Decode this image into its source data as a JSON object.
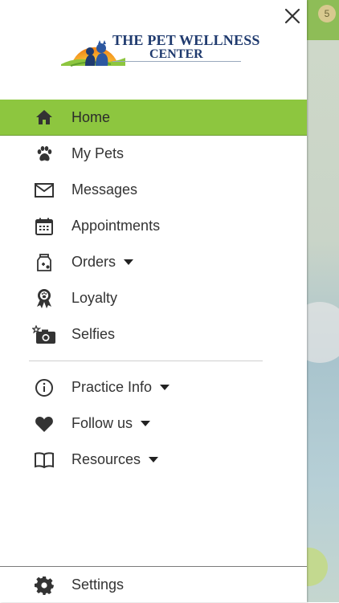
{
  "brand": {
    "line1": "THE PET WELLNESS",
    "line2": "CENTER",
    "accent_color": "#8dc63f",
    "navy": "#1f3a6e"
  },
  "background_app": {
    "badge_count": "5"
  },
  "menu": [
    {
      "label": "Home",
      "icon": "home-icon",
      "active": true
    },
    {
      "label": "My Pets",
      "icon": "paw-icon"
    },
    {
      "label": "Messages",
      "icon": "envelope-icon"
    },
    {
      "label": "Appointments",
      "icon": "calendar-icon"
    },
    {
      "label": "Orders",
      "icon": "pet-food-bag-icon",
      "has_dropdown": true
    },
    {
      "label": "Loyalty",
      "icon": "award-ribbon-icon"
    },
    {
      "label": "Selfies",
      "icon": "camera-star-icon"
    }
  ],
  "menu2": [
    {
      "label": "Practice Info",
      "icon": "info-icon",
      "has_dropdown": true
    },
    {
      "label": "Follow us",
      "icon": "heart-icon",
      "has_dropdown": true
    },
    {
      "label": "Resources",
      "icon": "book-icon",
      "has_dropdown": true
    }
  ],
  "footer": {
    "settings_label": "Settings",
    "icon": "gear-icon"
  }
}
